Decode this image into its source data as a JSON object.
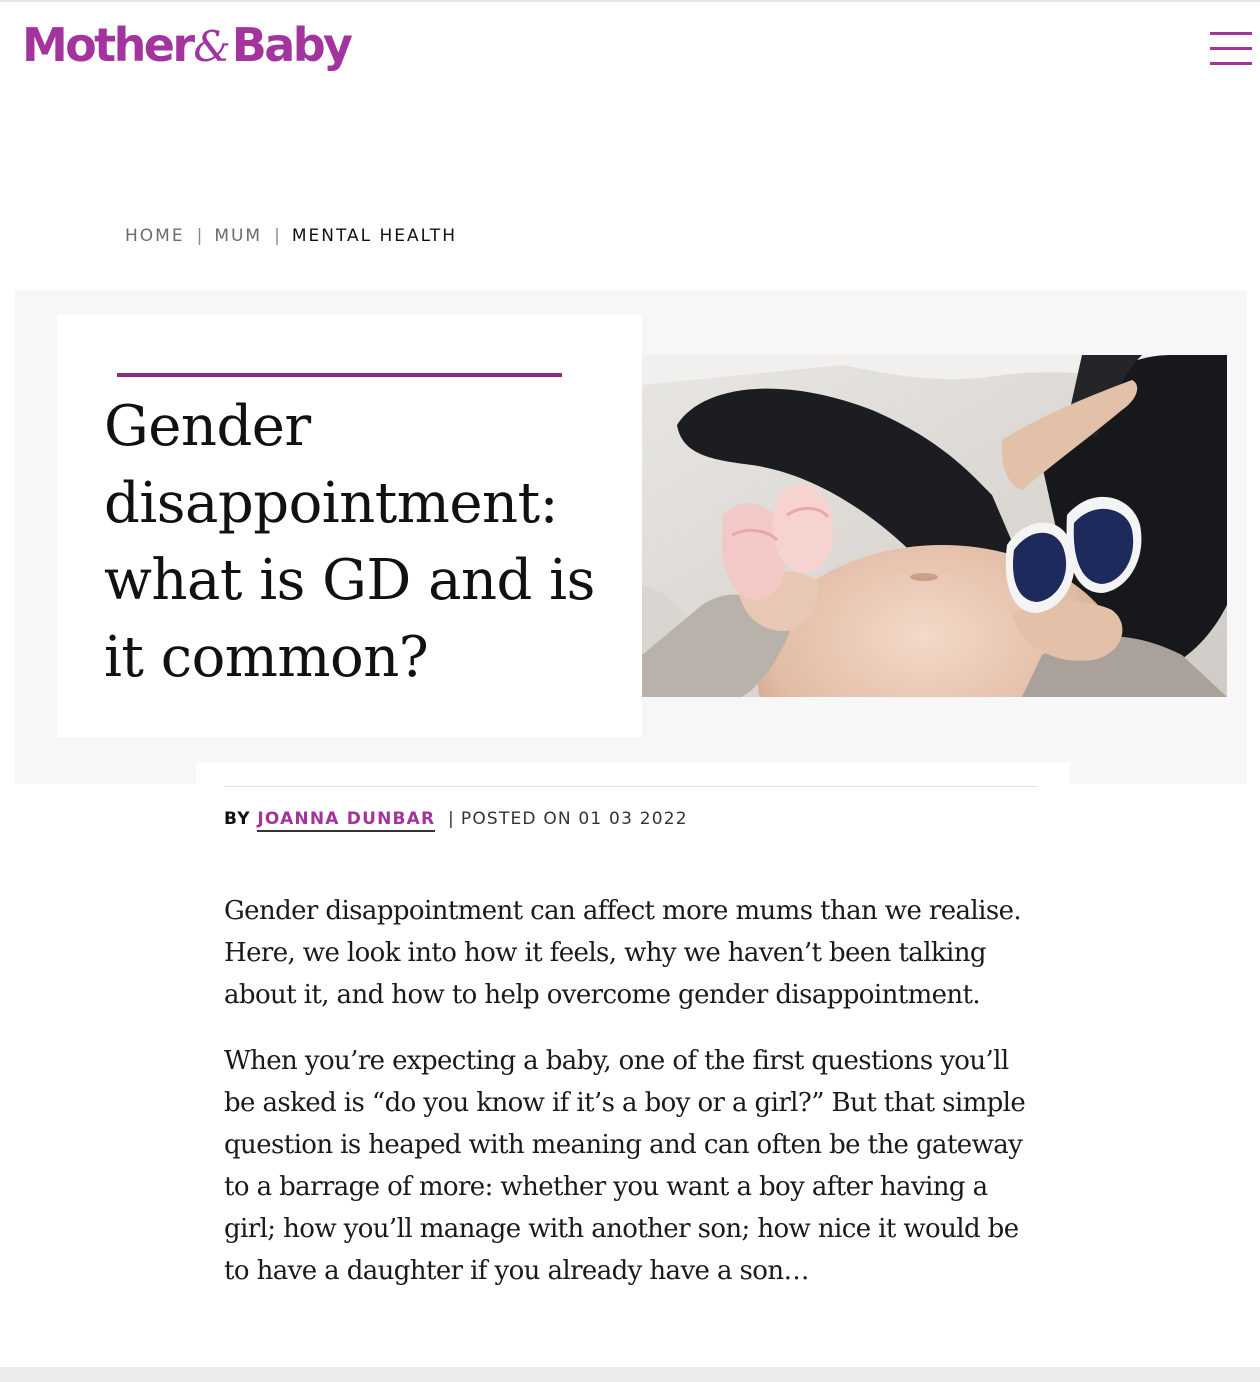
{
  "header": {
    "logo_part1": "Mother",
    "logo_amp": "&",
    "logo_part2": "Baby",
    "menu_icon": "hamburger-menu-icon"
  },
  "breadcrumb": {
    "items": [
      "HOME",
      "MUM",
      "MENTAL HEALTH"
    ],
    "separator": "|"
  },
  "article": {
    "title": "Gender disappointment: what is GD and is it common?",
    "hero_image_alt": "Pregnant woman holding pink and navy baby shoes",
    "byline": {
      "by": "BY",
      "author": "JOANNA DUNBAR",
      "separator": "|",
      "posted": "POSTED ON 01 03 2022"
    },
    "paragraphs": [
      "Gender disappointment can affect more mums than we realise. Here, we look into how it feels, why we haven’t been talking about it, and how to help overcome gender disappointment.",
      "When you’re expecting a baby, one of the first questions you’ll be asked is “do you know if it’s a boy or a girl?” But that simple question is heaped with meaning and can often be the gateway to a barrage of more: whether you want a boy after having a girl; how you’ll manage with another son; how nice it would be to have a daughter if you already have a son…"
    ]
  },
  "colors": {
    "brand": "#a3339d",
    "title_rule": "#8e2c85",
    "hero_bg": "#f7f7f7"
  }
}
